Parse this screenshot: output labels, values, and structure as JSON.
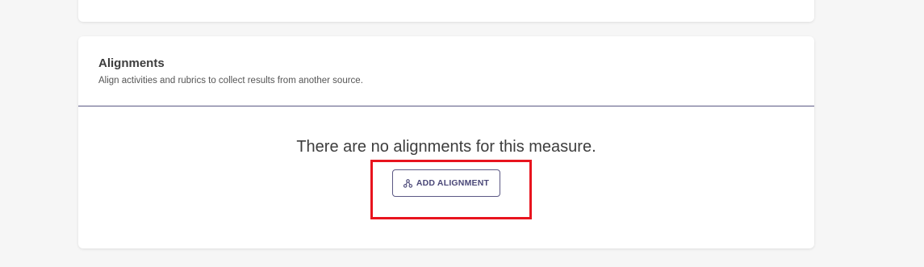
{
  "alignments": {
    "title": "Alignments",
    "subtitle": "Align activities and rubrics to collect results from another source.",
    "empty_message": "There are no alignments for this measure.",
    "add_button": {
      "label": "ADD ALIGNMENT",
      "icon": "alignment-nodes-icon"
    }
  },
  "colors": {
    "accent": "#5b5884",
    "highlight": "#e8141e",
    "background": "#f6f6f6"
  }
}
